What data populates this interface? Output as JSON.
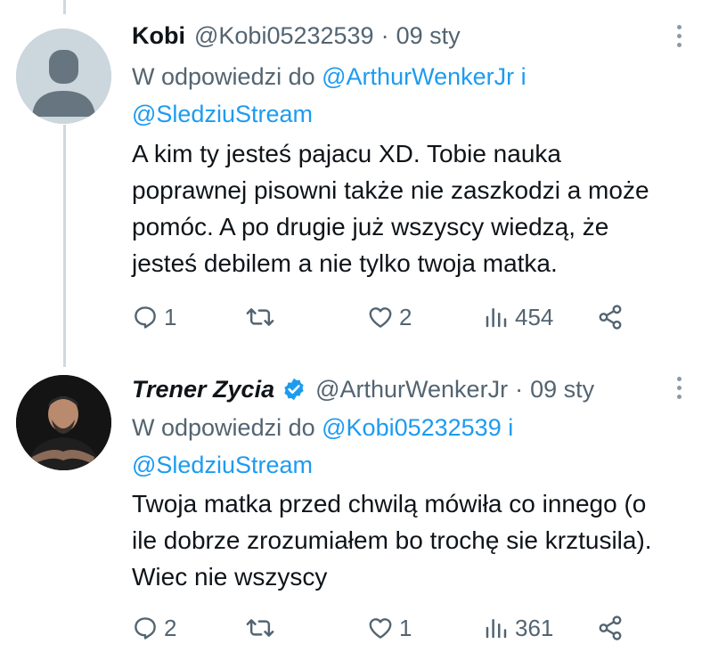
{
  "tweets": [
    {
      "name": "Kobi",
      "handle": "@Kobi05232539",
      "date": "09 sty",
      "reply_prefix": "W odpowiedzi do",
      "reply_mention_1": "@ArthurWenkerJr",
      "reply_and": "i",
      "reply_mention_2": "@SledziuStream",
      "text": "A kim ty jesteś pajacu XD. Tobie nauka poprawnej pisowni także nie zaszkodzi a może pomóc. A po drugie już wszyscy wiedzą, że jesteś debilem a nie tylko twoja matka.",
      "replies": "1",
      "retweets": "",
      "likes": "2",
      "views": "454",
      "verified": false
    },
    {
      "name": "Trener Zycia",
      "handle": "@ArthurWenkerJr",
      "date": "09 sty",
      "reply_prefix": "W odpowiedzi do",
      "reply_mention_1": "@Kobi05232539",
      "reply_and": "i",
      "reply_mention_2": "@SledziuStream",
      "text": "Twoja matka przed chwilą mówiła co innego (o ile dobrze zrozumiałem bo trochę sie krztusila). Wiec nie wszyscy",
      "replies": "2",
      "retweets": "",
      "likes": "1",
      "views": "361",
      "verified": true
    }
  ],
  "colors": {
    "link": "#1d9bf0",
    "secondary": "#536471",
    "verified": "#1d9bf0"
  }
}
